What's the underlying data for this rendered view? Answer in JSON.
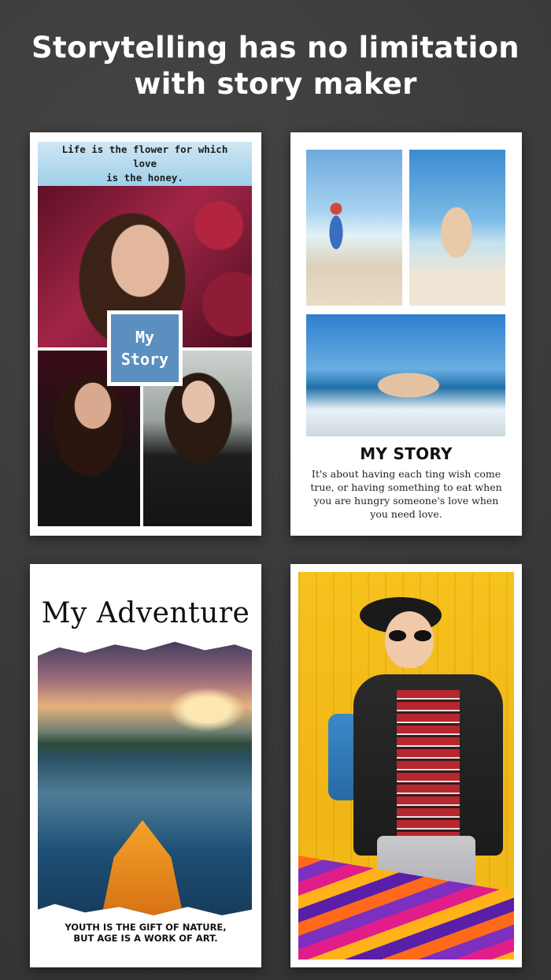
{
  "headline": {
    "line1": "Storytelling has no limitation",
    "line2": "with story maker"
  },
  "templates": [
    {
      "quote_line1": "Life is the flower for which love",
      "quote_line2": "is the honey.",
      "badge_line1": "My",
      "badge_line2": "Story"
    },
    {
      "title": "MY STORY",
      "body": "It's about having each ting wish come true, or having something to eat when you are hungry someone's love when you need love."
    },
    {
      "title": "My Adventure",
      "caption_line1": "YOUTH IS THE GIFT OF NATURE,",
      "caption_line2": "BUT AGE IS A WORK OF ART."
    },
    {}
  ]
}
